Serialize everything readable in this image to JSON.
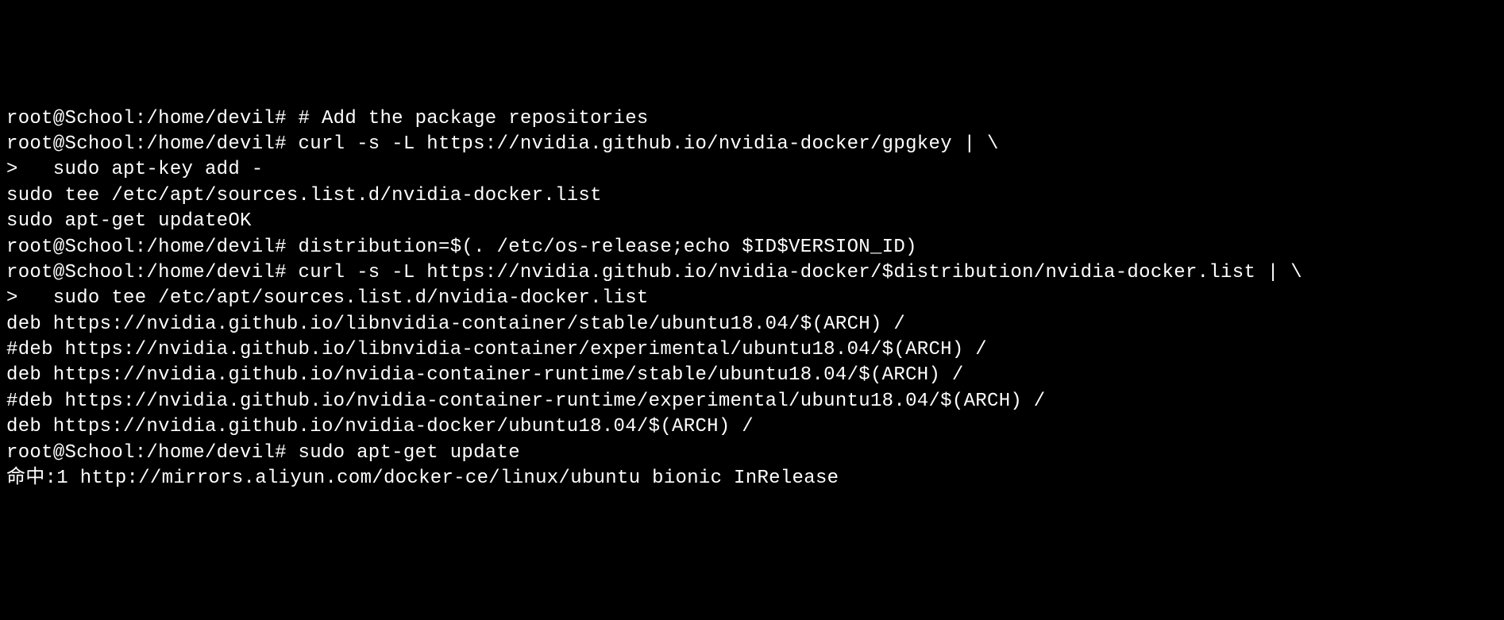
{
  "terminal": {
    "prompt": "root@School:/home/devil#",
    "continuation": ">",
    "lines": [
      {
        "type": "cmd",
        "prompt": "root@School:/home/devil#",
        "text": " # Add the package repositories"
      },
      {
        "type": "cmd",
        "prompt": "root@School:/home/devil#",
        "text": " curl -s -L https://nvidia.github.io/nvidia-docker/gpgkey | \\"
      },
      {
        "type": "cont",
        "prompt": ">",
        "text": "   sudo apt-key add -"
      },
      {
        "type": "out",
        "text": "sudo tee /etc/apt/sources.list.d/nvidia-docker.list"
      },
      {
        "type": "out",
        "text": "sudo apt-get updateOK"
      },
      {
        "type": "cmd",
        "prompt": "root@School:/home/devil#",
        "text": " distribution=$(. /etc/os-release;echo $ID$VERSION_ID)"
      },
      {
        "type": "cmd",
        "prompt": "root@School:/home/devil#",
        "text": " curl -s -L https://nvidia.github.io/nvidia-docker/$distribution/nvidia-docker.list | \\"
      },
      {
        "type": "cont",
        "prompt": ">",
        "text": "   sudo tee /etc/apt/sources.list.d/nvidia-docker.list"
      },
      {
        "type": "out",
        "text": "deb https://nvidia.github.io/libnvidia-container/stable/ubuntu18.04/$(ARCH) /"
      },
      {
        "type": "out",
        "text": "#deb https://nvidia.github.io/libnvidia-container/experimental/ubuntu18.04/$(ARCH) /"
      },
      {
        "type": "out",
        "text": "deb https://nvidia.github.io/nvidia-container-runtime/stable/ubuntu18.04/$(ARCH) /"
      },
      {
        "type": "out",
        "text": "#deb https://nvidia.github.io/nvidia-container-runtime/experimental/ubuntu18.04/$(ARCH) /"
      },
      {
        "type": "out",
        "text": "deb https://nvidia.github.io/nvidia-docker/ubuntu18.04/$(ARCH) /"
      },
      {
        "type": "cmd",
        "prompt": "root@School:/home/devil#",
        "text": " sudo apt-get update"
      },
      {
        "type": "out",
        "text": "命中:1 http://mirrors.aliyun.com/docker-ce/linux/ubuntu bionic InRelease"
      }
    ]
  }
}
